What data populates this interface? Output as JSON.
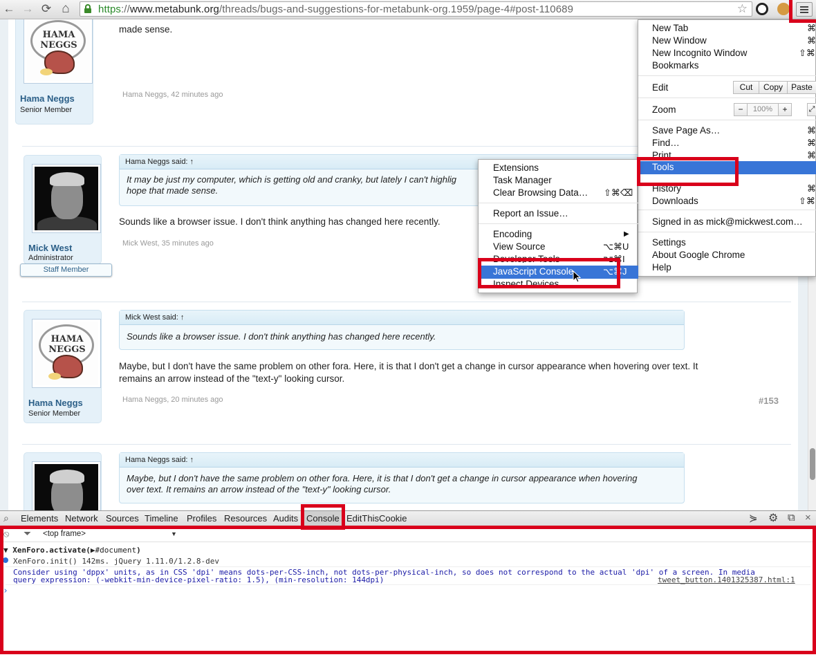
{
  "browser": {
    "url_scheme": "https",
    "url_sep": "://",
    "url_host": "www.metabunk.org",
    "url_path": "/threads/bugs-and-suggestions-for-metabunk-org.1959/page-4#post-110689",
    "nav_icons": [
      "back-icon",
      "forward-icon",
      "reload-icon",
      "home-icon"
    ],
    "glyphs": {
      "back": "←",
      "forward": "→",
      "reload": "⟳",
      "home": "⌂",
      "star": "☆"
    }
  },
  "posts": [
    {
      "author": "Hama Neggs",
      "author_title": "Senior Member",
      "message": "made sense.",
      "meta": "Hama Neggs, 42 minutes ago"
    },
    {
      "author": "Mick West",
      "author_title": "Administrator",
      "staff_badge": "Staff Member",
      "quote_head": "Hama Neggs said: ↑",
      "quote_line1": "It may be just my computer, which is getting old and cranky, but lately I can't highlig",
      "quote_line2": "hope that made sense.",
      "message": "Sounds like a browser issue. I don't think anything has changed here recently.",
      "meta": "Mick West, 35 minutes ago"
    },
    {
      "author": "Hama Neggs",
      "author_title": "Senior Member",
      "quote_head": "Mick West said: ↑",
      "quote_line1": "Sounds like a browser issue. I don't think anything has changed here recently.",
      "message_line1": "Maybe, but I don't have the same problem on other fora. Here, it is that I don't get a change in cursor appearance when hovering over text. It",
      "message_line2": "remains an arrow instead of the \"text-y\" looking cursor.",
      "meta": "Hama Neggs, 20 minutes ago",
      "post_number": "#153"
    },
    {
      "quote_head": "Hama Neggs said: ↑",
      "quote_line1": "Maybe, but I don't have the same problem on other fora. Here, it is that I don't get a change in cursor appearance when hovering",
      "quote_line2": "over text. It remains an arrow instead of the \"text-y\" looking cursor."
    }
  ],
  "chrome_menu": {
    "new_tab": "New Tab",
    "new_tab_key": "⌘",
    "new_window": "New Window",
    "new_window_key": "⌘",
    "new_incognito": "New Incognito Window",
    "new_incognito_key": "⇧⌘",
    "bookmarks": "Bookmarks",
    "edit": "Edit",
    "cut": "Cut",
    "copy": "Copy",
    "paste": "Paste",
    "zoom": "Zoom",
    "zoom_minus": "−",
    "zoom_level": "100%",
    "zoom_plus": "+",
    "save_page": "Save Page As…",
    "save_page_key": "⌘",
    "find": "Find…",
    "find_key": "⌘",
    "print": "Print…",
    "print_key": "⌘",
    "tools": "Tools",
    "history": "History",
    "history_key": "⌘",
    "downloads": "Downloads",
    "downloads_key": "⇧⌘",
    "signed_in": "Signed in as mick@mickwest.com…",
    "settings": "Settings",
    "about": "About Google Chrome",
    "help": "Help"
  },
  "tools_menu": {
    "extensions": "Extensions",
    "task_manager": "Task Manager",
    "clear_browsing": "Clear Browsing Data…",
    "clear_browsing_key": "⇧⌘⌫",
    "report_issue": "Report an Issue…",
    "encoding": "Encoding",
    "encoding_arrow": "▶",
    "view_source": "View Source",
    "view_source_key": "⌥⌘U",
    "developer_tools": "Developer Tools",
    "developer_tools_key": "⌥⌘I",
    "js_console": "JavaScript Console",
    "js_console_key": "⌥⌘J",
    "inspect_devices": "Inspect Devices"
  },
  "devtools": {
    "tabs": [
      "Elements",
      "Network",
      "Sources",
      "Timeline",
      "Profiles",
      "Resources",
      "Audits",
      "Console",
      "EditThisCookie"
    ],
    "active_tab": "Console",
    "frame_select": "<top frame>",
    "frame_arrow": "▼",
    "line1_prefix": "▼ XenForo.activate(",
    "line1_node": "▶#document",
    "line1_suffix": ")",
    "line2": "XenForo.init() 142ms. jQuery 1.11.0/1.2.8-dev",
    "line3a": "Consider using 'dppx' units, as in CSS 'dpi' means dots-per-CSS-inch, not dots-per-physical-inch, so does not correspond to the actual 'dpi' of a screen. In media",
    "line3b": "query expression: (-webkit-min-device-pixel-ratio: 1.5), (min-resolution: 144dpi)",
    "line3_source": "tweet_button.1401325387.html:1",
    "prompt": "›",
    "glyphs": {
      "drawer": "⋟",
      "settings": "⚙",
      "dock": "⧉",
      "close": "×",
      "clear": "⦸",
      "filter": "⏷"
    }
  },
  "colors": {
    "highlight": "#d9001b",
    "menu_selected": "#3875d7",
    "username": "#2b5f88",
    "console_info": "#1a1aa6"
  }
}
